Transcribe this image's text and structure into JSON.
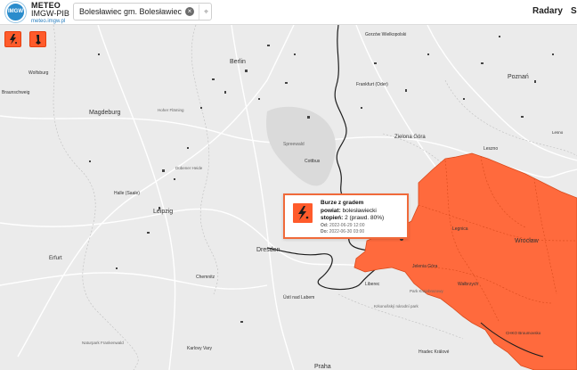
{
  "header": {
    "logo_text": "IMGW",
    "brand_line1": "METEO",
    "brand_line2": "IMGW-PIB",
    "brand_line3": "meteo.imgw.pl",
    "search": {
      "value": "Bolesławiec gm. Bolesławiec",
      "clear_label": "×",
      "locate_label": "⌖"
    },
    "nav": [
      {
        "label": "Radary"
      },
      {
        "label": "Sa"
      }
    ]
  },
  "legend": [
    {
      "name": "storm-warning",
      "icon": "lightning-icon"
    },
    {
      "name": "heat-warning",
      "icon": "thermometer-icon"
    }
  ],
  "popup": {
    "title": "Burze z gradem",
    "powiat_label": "powiat:",
    "powiat_value": "bolesławiecki",
    "level_label": "stopień:",
    "level_value": "2 (prawd. 80%)",
    "from_label": "Od:",
    "from_value": "2022-06-29 12:00",
    "to_label": "Do:",
    "to_value": "2022-06-30 03:00"
  },
  "map": {
    "warning_color": "#ff6a3d",
    "labels": [
      {
        "id": "city-berlin",
        "text": "Berlin"
      },
      {
        "id": "city-magdeburg",
        "text": "Magdeburg"
      },
      {
        "id": "city-leipzig",
        "text": "Leipzig"
      },
      {
        "id": "city-dresden",
        "text": "Dresden"
      },
      {
        "id": "city-erfurt",
        "text": "Erfurt"
      },
      {
        "id": "city-halle",
        "text": "Halle (Saale)"
      },
      {
        "id": "city-chemnitz",
        "text": "Chemnitz"
      },
      {
        "id": "city-praha",
        "text": "Praha"
      },
      {
        "id": "city-poznan",
        "text": "Poznań"
      },
      {
        "id": "city-wroclaw",
        "text": "Wrocław"
      },
      {
        "id": "city-legnica",
        "text": "Legnica"
      },
      {
        "id": "city-zielona-gora",
        "text": "Zielona Góra"
      },
      {
        "id": "city-leszno",
        "text": "Leszno"
      },
      {
        "id": "city-jelenia-gora",
        "text": "Jelenia Góra"
      },
      {
        "id": "city-walbrzych",
        "text": "Wałbrzych"
      },
      {
        "id": "city-gorzow",
        "text": "Gorzów Wielkopolski"
      },
      {
        "id": "city-liberec",
        "text": "Liberec"
      },
      {
        "id": "city-wolfsburg",
        "text": "Wolfsburg"
      },
      {
        "id": "city-braunschweig",
        "text": "Braunschweig"
      },
      {
        "id": "city-frankfurt-oder",
        "text": "Frankfurt (Oder)"
      },
      {
        "id": "city-cottbus",
        "text": "Cottbus"
      },
      {
        "id": "region-spreewald",
        "text": "Spreewald"
      },
      {
        "id": "region-hoher-flaming",
        "text": "Hoher Fläming"
      },
      {
        "id": "region-dubener",
        "text": "Dübener Heide"
      },
      {
        "id": "city-usti",
        "text": "Ústí nad Labem"
      },
      {
        "id": "city-karlovy-vary",
        "text": "Karlovy Vary"
      },
      {
        "id": "city-hradec",
        "text": "Hradec Králové"
      },
      {
        "id": "region-chko",
        "text": "CHKO Broumovsko"
      },
      {
        "id": "city-leszno-2",
        "text": "Lesno"
      },
      {
        "id": "region-jaworowski",
        "text": "Park Krajobrazowy"
      },
      {
        "id": "region-vogtland",
        "text": "Naturpark Frankenwald"
      },
      {
        "id": "city-kornowitz",
        "text": "Krkonošský národní park"
      }
    ]
  }
}
